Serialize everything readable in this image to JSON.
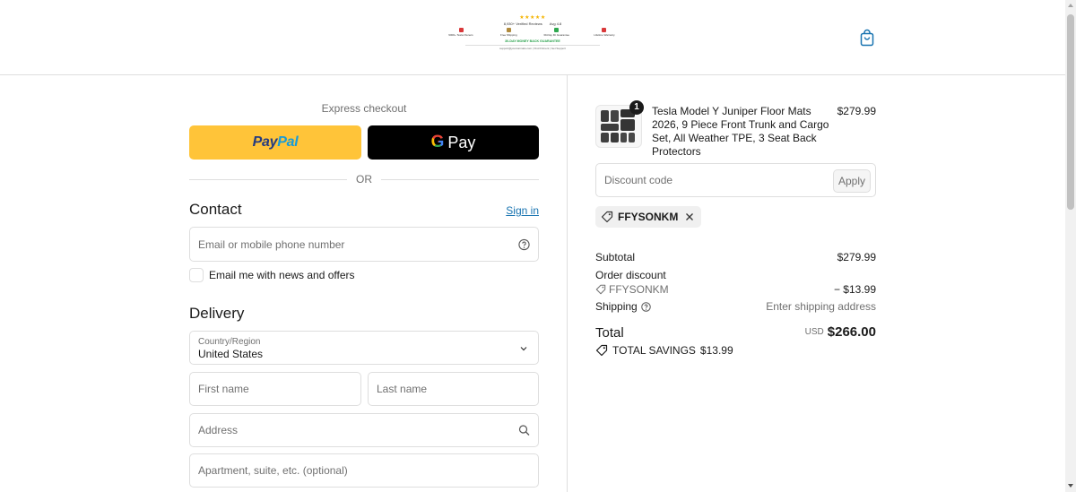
{
  "header": {
    "banner": {
      "stars": "★★★★★",
      "reviews": "8,930+ Verified Reviews",
      "rating": "Avg 4.8",
      "features": [
        "9000+ Tesla Owners",
        "Free Shipping",
        "30-Day Fit Guarantee",
        "Lifetime Warranty"
      ],
      "guarantee": "30-DAY MONEY BACK GUARANTEE",
      "footer_links": "support@yourcarmats.com  |  Find Fitment  |  Get Support"
    },
    "cart_icon": "shopping-bag-icon"
  },
  "express": {
    "title": "Express checkout",
    "paypal_a": "Pay",
    "paypal_b": "Pal",
    "gpay_g": "G",
    "gpay_pay": "Pay",
    "or": "OR"
  },
  "contact": {
    "heading": "Contact",
    "signin": "Sign in",
    "email_placeholder": "Email or mobile phone number",
    "newsletter_label": "Email me with news and offers"
  },
  "delivery": {
    "heading": "Delivery",
    "country_label": "Country/Region",
    "country_value": "United States",
    "first_name": "First name",
    "last_name": "Last name",
    "address": "Address",
    "apartment": "Apartment, suite, etc. (optional)"
  },
  "cart": {
    "item": {
      "title": "Tesla Model Y Juniper Floor Mats 2026, 9 Piece Front Trunk and Cargo Set, All Weather TPE, 3 Seat Back Protectors",
      "price": "$279.99",
      "qty": "1"
    },
    "discount_placeholder": "Discount code",
    "apply_label": "Apply",
    "applied_code": "FFYSONKM",
    "summary": {
      "subtotal_label": "Subtotal",
      "subtotal_value": "$279.99",
      "order_discount_label": "Order discount",
      "discount_code": "FFYSONKM",
      "discount_value": "− $13.99",
      "shipping_label": "Shipping",
      "shipping_value": "Enter shipping address",
      "total_label": "Total",
      "currency": "USD",
      "total_value": "$266.00",
      "savings_label": "TOTAL SAVINGS",
      "savings_value": "$13.99"
    }
  },
  "colors": {
    "paypal_yellow": "#ffc439",
    "link_blue": "#1773b0",
    "cart_icon_blue": "#1773b0"
  }
}
